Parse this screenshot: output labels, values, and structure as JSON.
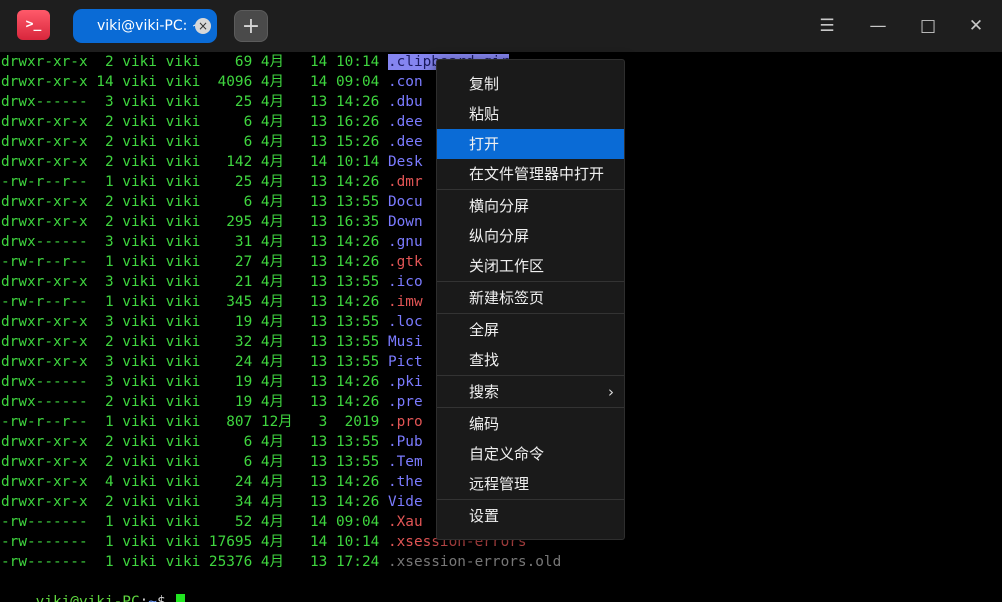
{
  "app": {
    "icon_glyph": ">_"
  },
  "tab": {
    "title": "viki@viki-PC: ~",
    "close_glyph": "×"
  },
  "new_tab_glyph": "+",
  "window_controls": {
    "menu_glyph": "☰",
    "minimize_glyph": "—",
    "maximize_glyph": "□",
    "close_glyph": "✕"
  },
  "listing": [
    {
      "perm": "drwxr-xr-x",
      "links": "2",
      "user": "viki",
      "group": "viki",
      "size": "69",
      "month": "4月",
      "day": "14",
      "time": "10:14",
      "name": ".clipboard-gir",
      "kind": "dir"
    },
    {
      "perm": "drwxr-xr-x",
      "links": "14",
      "user": "viki",
      "group": "viki",
      "size": "4096",
      "month": "4月",
      "day": "14",
      "time": "09:04",
      "name": ".con",
      "kind": "dir"
    },
    {
      "perm": "drwx------",
      "links": "3",
      "user": "viki",
      "group": "viki",
      "size": "25",
      "month": "4月",
      "day": "13",
      "time": "14:26",
      "name": ".dbu",
      "kind": "dir"
    },
    {
      "perm": "drwxr-xr-x",
      "links": "2",
      "user": "viki",
      "group": "viki",
      "size": "6",
      "month": "4月",
      "day": "13",
      "time": "16:26",
      "name": ".dee",
      "kind": "dir"
    },
    {
      "perm": "drwxr-xr-x",
      "links": "2",
      "user": "viki",
      "group": "viki",
      "size": "6",
      "month": "4月",
      "day": "13",
      "time": "15:26",
      "name": ".dee",
      "kind": "dir"
    },
    {
      "perm": "drwxr-xr-x",
      "links": "2",
      "user": "viki",
      "group": "viki",
      "size": "142",
      "month": "4月",
      "day": "14",
      "time": "10:14",
      "name": "Desk",
      "kind": "dir"
    },
    {
      "perm": "-rw-r--r--",
      "links": "1",
      "user": "viki",
      "group": "viki",
      "size": "25",
      "month": "4月",
      "day": "13",
      "time": "14:26",
      "name": ".dmr",
      "kind": "file"
    },
    {
      "perm": "drwxr-xr-x",
      "links": "2",
      "user": "viki",
      "group": "viki",
      "size": "6",
      "month": "4月",
      "day": "13",
      "time": "13:55",
      "name": "Docu",
      "kind": "dir"
    },
    {
      "perm": "drwxr-xr-x",
      "links": "2",
      "user": "viki",
      "group": "viki",
      "size": "295",
      "month": "4月",
      "day": "13",
      "time": "16:35",
      "name": "Down",
      "kind": "dir"
    },
    {
      "perm": "drwx------",
      "links": "3",
      "user": "viki",
      "group": "viki",
      "size": "31",
      "month": "4月",
      "day": "13",
      "time": "14:26",
      "name": ".gnu",
      "kind": "dir"
    },
    {
      "perm": "-rw-r--r--",
      "links": "1",
      "user": "viki",
      "group": "viki",
      "size": "27",
      "month": "4月",
      "day": "13",
      "time": "14:26",
      "name": ".gtk",
      "kind": "file"
    },
    {
      "perm": "drwxr-xr-x",
      "links": "3",
      "user": "viki",
      "group": "viki",
      "size": "21",
      "month": "4月",
      "day": "13",
      "time": "13:55",
      "name": ".ico",
      "kind": "dir"
    },
    {
      "perm": "-rw-r--r--",
      "links": "1",
      "user": "viki",
      "group": "viki",
      "size": "345",
      "month": "4月",
      "day": "13",
      "time": "14:26",
      "name": ".imw",
      "kind": "file"
    },
    {
      "perm": "drwxr-xr-x",
      "links": "3",
      "user": "viki",
      "group": "viki",
      "size": "19",
      "month": "4月",
      "day": "13",
      "time": "13:55",
      "name": ".loc",
      "kind": "dir"
    },
    {
      "perm": "drwxr-xr-x",
      "links": "2",
      "user": "viki",
      "group": "viki",
      "size": "32",
      "month": "4月",
      "day": "13",
      "time": "13:55",
      "name": "Musi",
      "kind": "dir"
    },
    {
      "perm": "drwxr-xr-x",
      "links": "3",
      "user": "viki",
      "group": "viki",
      "size": "24",
      "month": "4月",
      "day": "13",
      "time": "13:55",
      "name": "Pict",
      "kind": "dir"
    },
    {
      "perm": "drwx------",
      "links": "3",
      "user": "viki",
      "group": "viki",
      "size": "19",
      "month": "4月",
      "day": "13",
      "time": "14:26",
      "name": ".pki",
      "kind": "dir"
    },
    {
      "perm": "drwx------",
      "links": "2",
      "user": "viki",
      "group": "viki",
      "size": "19",
      "month": "4月",
      "day": "13",
      "time": "14:26",
      "name": ".pre",
      "kind": "dir"
    },
    {
      "perm": "-rw-r--r--",
      "links": "1",
      "user": "viki",
      "group": "viki",
      "size": "807",
      "month": "12月",
      "day": "3",
      "time": "2019",
      "name": ".pro",
      "kind": "file"
    },
    {
      "perm": "drwxr-xr-x",
      "links": "2",
      "user": "viki",
      "group": "viki",
      "size": "6",
      "month": "4月",
      "day": "13",
      "time": "13:55",
      "name": ".Pub",
      "kind": "dir"
    },
    {
      "perm": "drwxr-xr-x",
      "links": "2",
      "user": "viki",
      "group": "viki",
      "size": "6",
      "month": "4月",
      "day": "13",
      "time": "13:55",
      "name": ".Tem",
      "kind": "dir"
    },
    {
      "perm": "drwxr-xr-x",
      "links": "4",
      "user": "viki",
      "group": "viki",
      "size": "24",
      "month": "4月",
      "day": "13",
      "time": "14:26",
      "name": ".the",
      "kind": "dir"
    },
    {
      "perm": "drwxr-xr-x",
      "links": "2",
      "user": "viki",
      "group": "viki",
      "size": "34",
      "month": "4月",
      "day": "13",
      "time": "14:26",
      "name": "Vide",
      "kind": "dir"
    },
    {
      "perm": "-rw-------",
      "links": "1",
      "user": "viki",
      "group": "viki",
      "size": "52",
      "month": "4月",
      "day": "14",
      "time": "09:04",
      "name": ".Xau",
      "kind": "file"
    },
    {
      "perm": "-rw-------",
      "links": "1",
      "user": "viki",
      "group": "viki",
      "size": "17695",
      "month": "4月",
      "day": "14",
      "time": "10:14",
      "name": ".xsession-errors",
      "kind": "file"
    },
    {
      "perm": "-rw-------",
      "links": "1",
      "user": "viki",
      "group": "viki",
      "size": "25376",
      "month": "4月",
      "day": "13",
      "time": "17:24",
      "name": ".xsession-errors.old",
      "kind": "gray"
    }
  ],
  "prompt": {
    "user": "viki@viki-PC",
    "sep": ":",
    "path": "~",
    "symbol": "$ "
  },
  "context_menu": {
    "items": [
      {
        "label": "复制"
      },
      {
        "label": "粘贴"
      },
      {
        "label": "打开",
        "active": true
      },
      {
        "label": "在文件管理器中打开"
      },
      {
        "label": "横向分屏"
      },
      {
        "label": "纵向分屏"
      },
      {
        "label": "关闭工作区"
      },
      {
        "label": "新建标签页"
      },
      {
        "label": "全屏"
      },
      {
        "label": "查找"
      },
      {
        "label": "搜索",
        "submenu": true
      },
      {
        "label": "编码"
      },
      {
        "label": "自定义命令"
      },
      {
        "label": "远程管理"
      },
      {
        "label": "设置"
      }
    ],
    "submenu_arrow": "›"
  },
  "colors": {
    "accent": "#0a6bd6",
    "perm_green": "#3fd63f",
    "dir_blue": "#7b7bff",
    "file_red": "#e25555",
    "cursor": "#21e521"
  }
}
